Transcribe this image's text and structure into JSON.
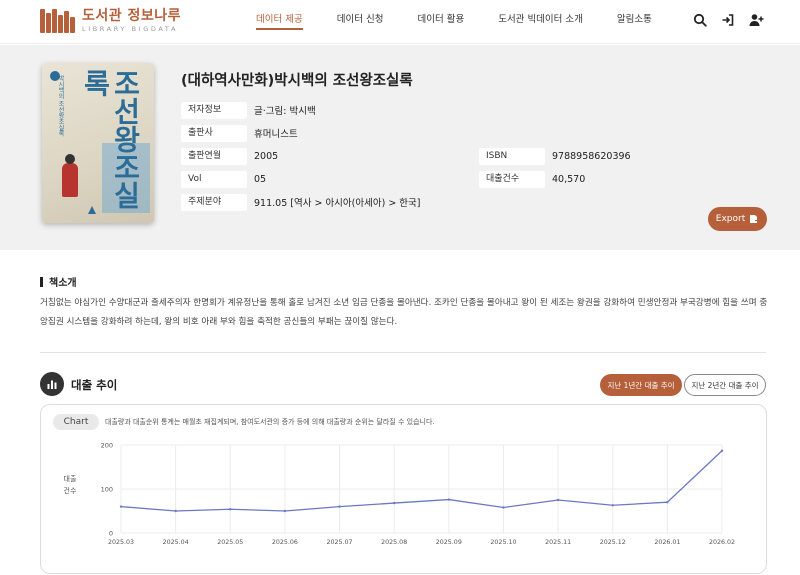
{
  "header": {
    "logo_title": "도서관 정보나루",
    "logo_sub": "LIBRARY BIGDATA",
    "nav": [
      "데이터 제공",
      "데이터 신청",
      "데이터 활용",
      "도서관 빅데이터 소개",
      "알림소통"
    ],
    "active_nav": 0,
    "icons": [
      "search-icon",
      "login-icon",
      "signup-icon"
    ]
  },
  "book": {
    "title": "(대하역사만화)박시백의 조선왕조실록",
    "cover_title": "조선왕조실록",
    "cover_sub": "박시백의 조선왕조실록",
    "info": {
      "author_label": "저자정보",
      "author": "글·그림: 박시백",
      "publisher_label": "출판사",
      "publisher": "휴머니스트",
      "year_label": "출판연월",
      "year": "2005",
      "vol_label": "Vol",
      "vol": "05",
      "subject_label": "주제분야",
      "subject": "911.05 [역사 > 아시아(아세아) > 한국]",
      "isbn_label": "ISBN",
      "isbn": "9788958620396",
      "loans_label": "대출건수",
      "loans": "40,570"
    },
    "export_label": "Export"
  },
  "intro": {
    "heading": "책소개",
    "text": "거침없는 야심가인 수양대군과 출세주의자 한명회가 계유정난을 통해 홀로 남겨진 소년 임금 단종을 몰아낸다. 조카인 단종을 몰아내고 왕이 된 세조는 왕권을 강화하여 민생안정과 부국강병에 힘을 쓰며 중앙집권 시스템을 강화하려 하는데, 왕의 비호 아래 부와 힘을 축적한 공신들의 부패는 끊이질 않는다."
  },
  "trend": {
    "title": "대출 추이",
    "period_1y": "지난 1년간 대출 추이",
    "period_2y": "지난 2년간 대출 추이",
    "chart_tag": "Chart",
    "note": "대출량과 대출순위 통계는 매월초 재집계되며, 참여도서관의 증가 등에 의해 대출량과 순위는 달라질 수 있습니다.",
    "ylabel_1": "대출",
    "ylabel_2": "건수"
  },
  "colors": {
    "accent": "#b5603a",
    "line": "#6b78c4"
  },
  "chart_data": {
    "type": "line",
    "categories": [
      "2025.03",
      "2025.04",
      "2025.05",
      "2025.06",
      "2025.07",
      "2025.08",
      "2025.09",
      "2025.10",
      "2025.11",
      "2025.12",
      "2026.01",
      "2026.02"
    ],
    "series": [
      {
        "values": [
          60,
          50,
          54,
          50,
          60,
          68,
          76,
          58,
          75,
          63,
          70,
          187
        ]
      }
    ],
    "yticks": [
      0,
      100,
      200
    ],
    "ylim": [
      0,
      200
    ],
    "ylabel": "대출 건수",
    "grid": true
  }
}
